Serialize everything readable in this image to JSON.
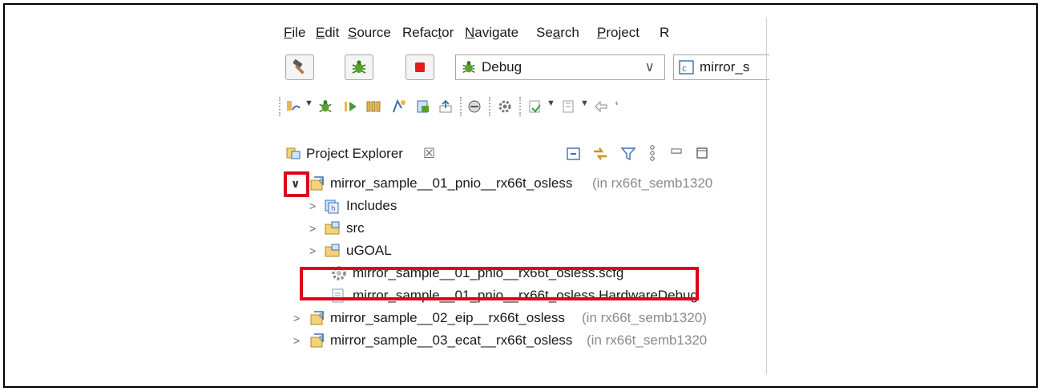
{
  "menubar": {
    "items": [
      {
        "label": "File"
      },
      {
        "label": "Edit"
      },
      {
        "label": "Source"
      },
      {
        "label": "Refactor"
      },
      {
        "label": "Navigate"
      },
      {
        "label": "Search"
      },
      {
        "label": "Project"
      },
      {
        "label": "R"
      }
    ]
  },
  "launchbar": {
    "build_icon": "hammer-icon",
    "debug_icon": "bug-icon",
    "stop_icon": "stop-icon",
    "mode_value": "Debug",
    "config_value": "mirror_s"
  },
  "panel": {
    "title": "Project Explorer",
    "close_glyph": "☒"
  },
  "tree": {
    "projects": [
      {
        "name": "mirror_sample__01_pnio__rx66t_osless",
        "suffix": "(in rx66t_semb1320"
      },
      {
        "name": "mirror_sample__02_eip__rx66t_osless",
        "suffix": "(in rx66t_semb1320)"
      },
      {
        "name": "mirror_sample__03_ecat__rx66t_osless",
        "suffix": "(in rx66t_semb1320"
      }
    ],
    "children": [
      {
        "label": "Includes"
      },
      {
        "label": "src"
      },
      {
        "label": "uGOAL"
      },
      {
        "label": "mirror_sample__01_pnio__rx66t_osless.scfg"
      },
      {
        "label": "mirror_sample__01_pnio__rx66t_osless HardwareDebug"
      }
    ]
  },
  "colors": {
    "highlight": "#e0001a",
    "suffix_gray": "#8a8a8a"
  }
}
